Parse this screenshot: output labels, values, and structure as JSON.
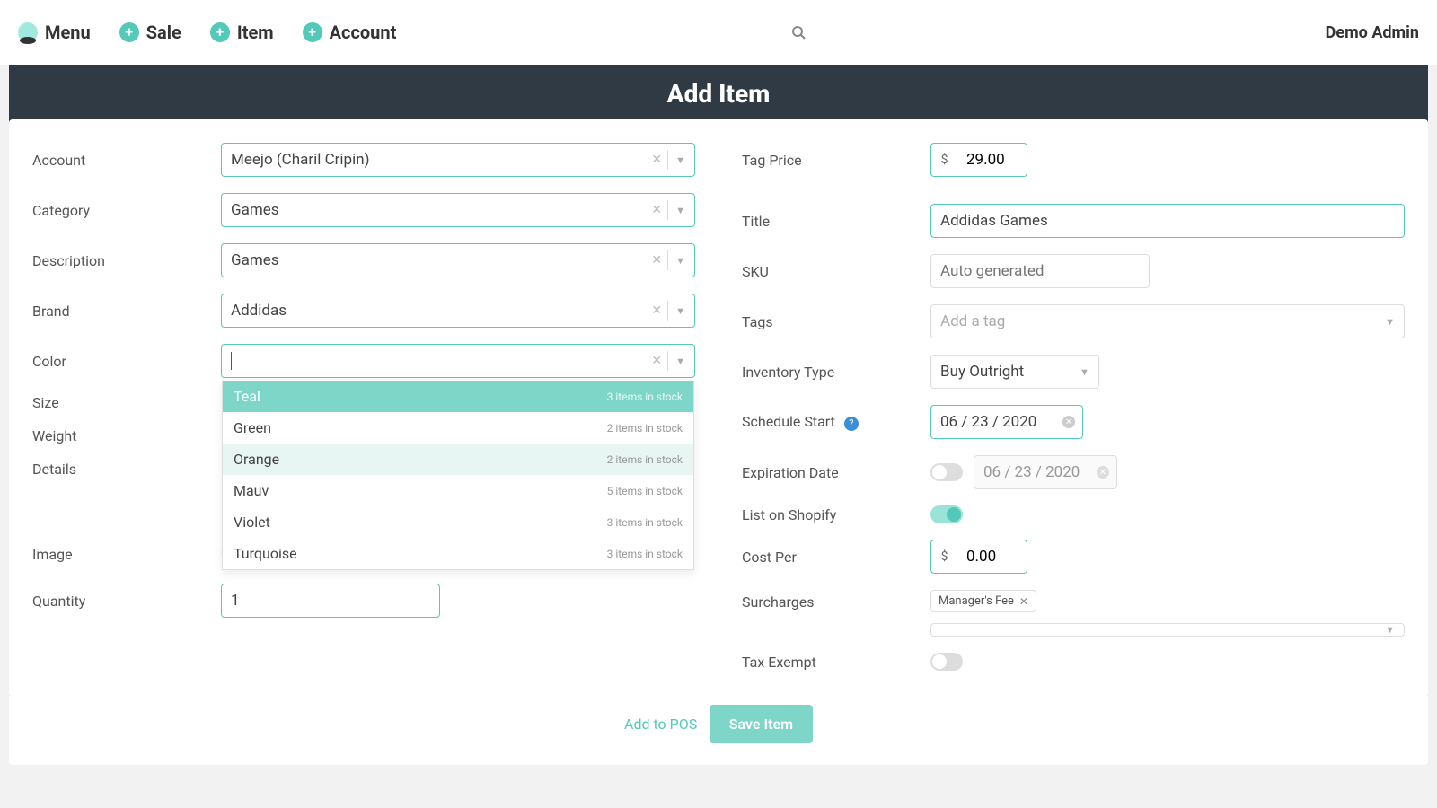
{
  "header": {
    "nav": {
      "menu": "Menu",
      "sale": "Sale",
      "item": "Item",
      "account": "Account"
    },
    "user": "Demo Admin"
  },
  "page": {
    "title": "Add Item"
  },
  "left": {
    "labels": {
      "account": "Account",
      "category": "Category",
      "description": "Description",
      "brand": "Brand",
      "color": "Color",
      "size": "Size",
      "weight": "Weight",
      "details": "Details",
      "image": "Image",
      "quantity": "Quantity"
    },
    "values": {
      "account": "Meejo (Charil Cripin)",
      "category": "Games",
      "description": "Games",
      "brand": "Addidas",
      "color": "",
      "quantity": "1"
    },
    "color_options": [
      {
        "name": "Teal",
        "stock": "3 items in stock",
        "state": "selected"
      },
      {
        "name": "Green",
        "stock": "2 items in stock",
        "state": ""
      },
      {
        "name": "Orange",
        "stock": "2 items in stock",
        "state": "hover"
      },
      {
        "name": "Mauv",
        "stock": "5 items in stock",
        "state": ""
      },
      {
        "name": "Violet",
        "stock": "3 items in stock",
        "state": ""
      },
      {
        "name": "Turquoise",
        "stock": "3 items in stock",
        "state": ""
      }
    ]
  },
  "right": {
    "labels": {
      "tag_price": "Tag Price",
      "title": "Title",
      "sku": "SKU",
      "tags": "Tags",
      "inventory_type": "Inventory Type",
      "schedule_start": "Schedule Start",
      "expiration_date": "Expiration Date",
      "list_on_shopify": "List on Shopify",
      "cost_per": "Cost Per",
      "surcharges": "Surcharges",
      "tax_exempt": "Tax Exempt"
    },
    "values": {
      "currency": "$",
      "tag_price": "29.00",
      "title": "Addidas Games",
      "sku_placeholder": "Auto generated",
      "tags_placeholder": "Add a tag",
      "inventory_type": "Buy Outright",
      "schedule_start": "06 / 23 / 2020",
      "expiration_date": "06 / 23 / 2020",
      "cost_per": "0.00",
      "surcharge_chip": "Manager's Fee"
    }
  },
  "actions": {
    "add_to_pos": "Add to POS",
    "save": "Save Item"
  }
}
